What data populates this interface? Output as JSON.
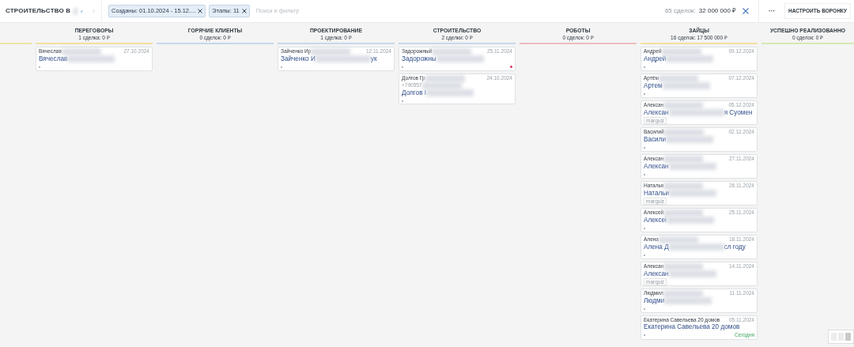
{
  "topbar": {
    "title": "СТРОИТЕЛЬСТВО В",
    "filters": [
      {
        "label": "Созданы: 01.10.2024 - 15.12...."
      },
      {
        "label": "Этапы: 11"
      }
    ],
    "search": {
      "placeholder": "Поиск и фильтр"
    },
    "summary_count": "65 сделок:",
    "summary_sum": "32 000 000 ₽",
    "more": "···",
    "setup_button": "НАСТРОИТЬ ВОРОНКУ"
  },
  "columns": [
    {
      "title": "ПЕРЕГОВОРЫ",
      "subtitle": "1 сделка: 0 ₽",
      "color": "#f3dfa2",
      "cards": [
        {
          "name": "Вячеслав",
          "date": "27.10.2024",
          "title": "Вячеслав",
          "kind": "dot"
        }
      ]
    },
    {
      "title": "ГОРЯЧИЕ КЛИЕНТЫ",
      "subtitle": "0 сделок: 0 ₽",
      "color": "#c7d8ec"
    },
    {
      "title": "ПРОЕКТИРОВАНИЕ",
      "subtitle": "1 сделка: 0 ₽",
      "color": "#c7d8ec",
      "cards": [
        {
          "name": "Зайченко Ир",
          "date": "12.11.2024",
          "title": "Зайченко И",
          "title_end": "ук",
          "kind": "dot"
        }
      ]
    },
    {
      "title": "СТРОИТЕЛЬСТВО",
      "subtitle": "2 сделки: 0 ₽",
      "color": "#c7d8ec",
      "cards": [
        {
          "name": "Задорожный",
          "date": "25.11.2024",
          "title": "Задорожны",
          "kind": "overdue"
        },
        {
          "name": "Долгов Гр",
          "phone": "+790557",
          "date": "24.10.2024",
          "title": "Долгов I",
          "kind": "dot"
        }
      ]
    },
    {
      "title": "РОБОТЫ",
      "subtitle": "0 сделок: 0 ₽",
      "color": "#efbcbc"
    },
    {
      "title": "ЗАЙЦЫ",
      "subtitle": "16 сделок: 17 500 000 ₽",
      "color": "#f3dfa2",
      "cards": [
        {
          "name": "Андрей",
          "date": "09.12.2024",
          "title": "Андрей",
          "kind": "dot"
        },
        {
          "name": "Артём",
          "date": "07.12.2024",
          "title": "Артем",
          "kind": "dot"
        },
        {
          "name": "Алексан",
          "date": "05.12.2024",
          "title": "Алексан",
          "title_end": "я Суомен",
          "kind": "tag",
          "tag": "marquiz"
        },
        {
          "name": "Василий",
          "date": "02.12.2024",
          "title": "Васили",
          "kind": "dot"
        },
        {
          "name": "Алексан",
          "date": "27.11.2024",
          "title": "Алексан",
          "kind": "dot"
        },
        {
          "name": "Наталья",
          "date": "26.11.2024",
          "title": "Натальи",
          "kind": "tag",
          "tag": "marquiz"
        },
        {
          "name": "Алексей",
          "date": "25.11.2024",
          "title": "Алексеі",
          "kind": "dot"
        },
        {
          "name": "Алена",
          "date": "18.11.2024",
          "title": "Алена Д",
          "title_end": "сл году",
          "kind": "dot"
        },
        {
          "name": "Алексан",
          "date": "14.11.2024",
          "title": "Алексан",
          "kind": "tag",
          "tag": "marquiz"
        },
        {
          "name": "Людмил",
          "date": "11.11.2024",
          "title": "Людми",
          "kind": "dot"
        },
        {
          "name": "Екатерина Савельева 20 домов",
          "date": "05.11.2024",
          "title": "Екатерина Савельева 20 домов",
          "kind": "today",
          "today": "Сегодня",
          "clear": true
        }
      ]
    },
    {
      "title": "УСПЕШНО РЕАЛИЗОВАННО",
      "subtitle": "0 сделок: 0 ₽",
      "color": "#d2ebb4"
    }
  ],
  "view_modes": [
    {
      "selected": false
    },
    {
      "selected": false
    },
    {
      "selected": true
    }
  ]
}
